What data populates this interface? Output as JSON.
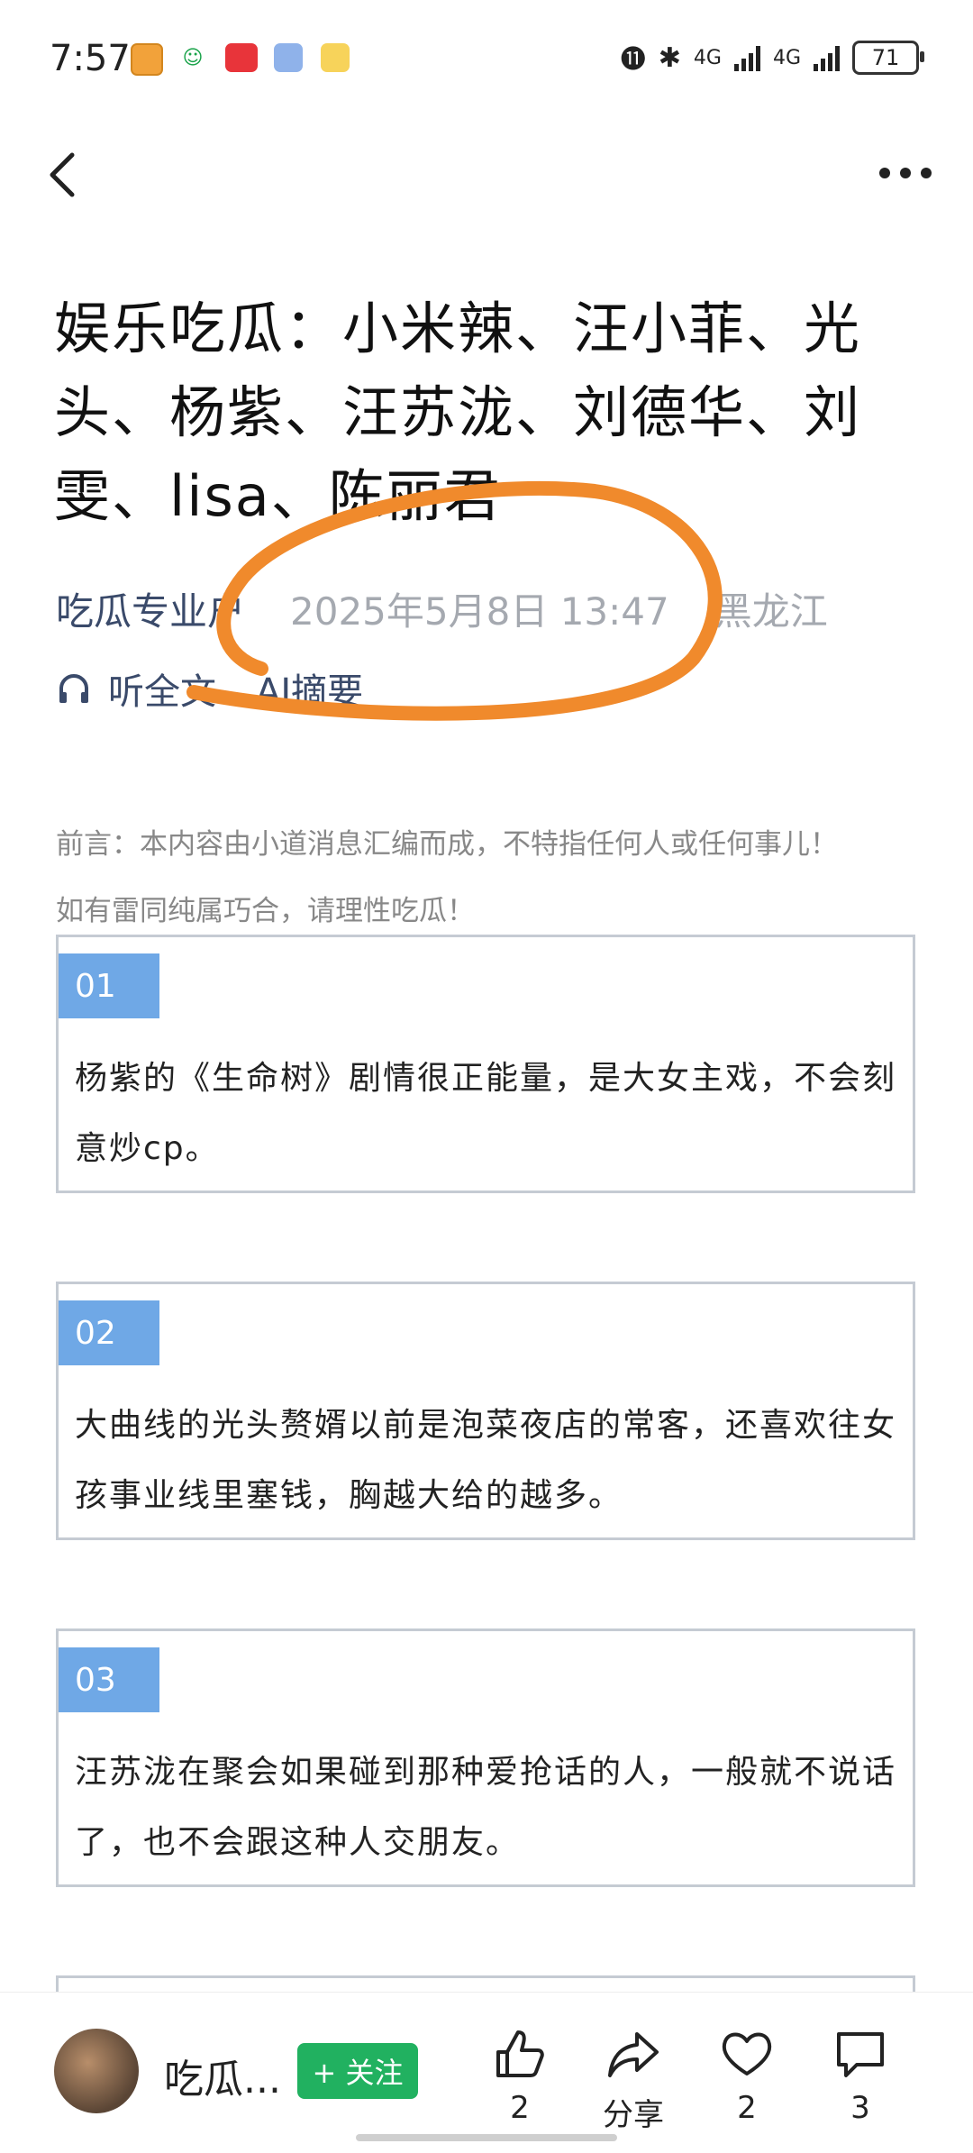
{
  "status": {
    "time": "7:57",
    "battery": "71",
    "net1": "4G",
    "net2": "4G"
  },
  "article": {
    "title": "娱乐吃瓜：小米辣、汪小菲、光头、杨紫、汪苏泷、刘德华、刘雯、lisa、陈丽君",
    "author": "吃瓜专业户",
    "date": "2025年5月8日 13:47",
    "location": "黑龙江",
    "listen_label": "听全文",
    "ai_label": "AI摘要",
    "preface_line1": "前言：本内容由小道消息汇编而成，不特指任何人或任何事儿！",
    "preface_line2": "如有雷同纯属巧合，请理性吃瓜！",
    "items": [
      {
        "num": "01",
        "text": "杨紫的《生命树》剧情很正能量，是大女主戏，不会刻意炒cp。"
      },
      {
        "num": "02",
        "text": "大曲线的光头赘婿以前是泡菜夜店的常客，还喜欢往女孩事业线里塞钱，胸越大给的越多。"
      },
      {
        "num": "03",
        "text": "汪苏泷在聚会如果碰到那种爱抢话的人，一般就不说话了，也不会跟这种人交朋友。"
      }
    ]
  },
  "bottom": {
    "author_short": "吃瓜...",
    "follow_label": "+ 关注",
    "like_count": "2",
    "share_label": "分享",
    "favorite_count": "2",
    "comment_count": "3"
  },
  "colors": {
    "accent": "#6fa8e6",
    "follow": "#21b160",
    "annotation": "#f08a2c"
  }
}
